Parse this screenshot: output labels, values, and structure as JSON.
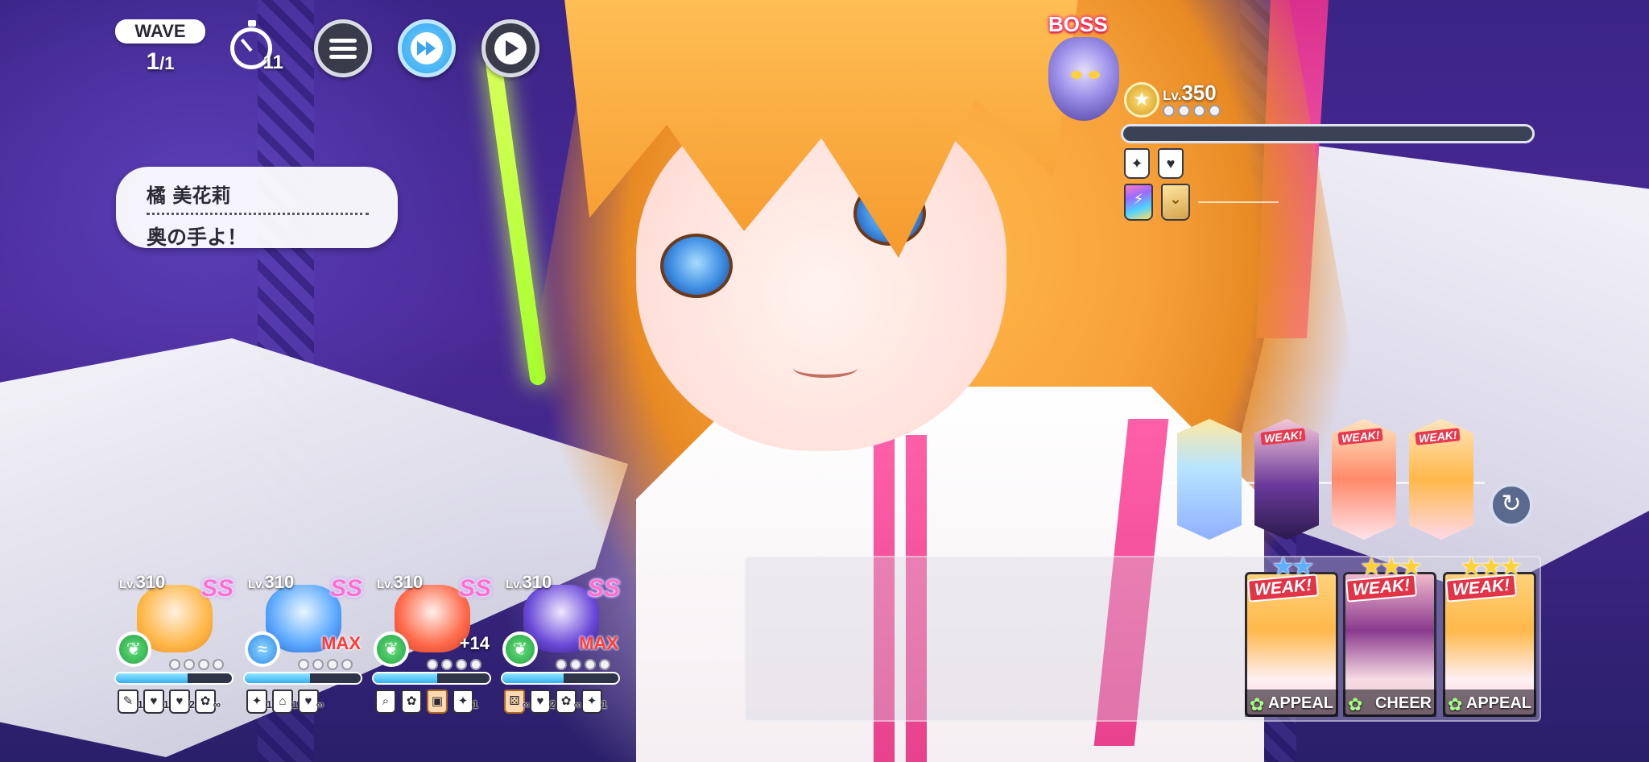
{
  "hud": {
    "wave_label": "WAVE",
    "wave_current": "1",
    "wave_total": "/1",
    "timer_value": "11"
  },
  "dialogue": {
    "speaker": "橘 美花莉",
    "text": "奥の手よ！"
  },
  "boss": {
    "tag": "BOSS",
    "level_prefix": "Lv.",
    "level": "350",
    "rank_icon": "star-medal-icon",
    "buffs_row1": [
      "sparkle-icon",
      "heart-infinity-icon"
    ],
    "buffs_row2": [
      "rainbow-crystal-icon",
      "gold-chevron-icon"
    ]
  },
  "party": [
    {
      "level_prefix": "Lv.",
      "level": "310",
      "rarity": "SS",
      "attribute": "leaf",
      "attr_symbol": "❦",
      "tag": "",
      "hp_fraction": 0.62,
      "skills": [
        {
          "icon": "pen-icon",
          "count": "1"
        },
        {
          "icon": "heart-icon",
          "count": "1"
        },
        {
          "icon": "heart-icon",
          "count": "2"
        },
        {
          "icon": "flower-icon",
          "count": "∞"
        }
      ]
    },
    {
      "level_prefix": "Lv.",
      "level": "310",
      "rarity": "SS",
      "attribute": "water",
      "attr_symbol": "≈",
      "tag": "MAX",
      "hp_fraction": 0.56,
      "skills": [
        {
          "icon": "sparkle-icon",
          "count": "1"
        },
        {
          "icon": "house-icon",
          "count": "1"
        },
        {
          "icon": "heart-icon",
          "count": "∞"
        }
      ]
    },
    {
      "level_prefix": "Lv.",
      "level": "310",
      "rarity": "SS",
      "attribute": "leaf",
      "attr_symbol": "❦",
      "tag": "+14",
      "hp_fraction": 0.55,
      "skills": [
        {
          "icon": "search-icon",
          "count": ""
        },
        {
          "icon": "flower-icon",
          "count": ""
        },
        {
          "icon": "card-icon",
          "count": ""
        },
        {
          "icon": "sparkle-icon",
          "count": "1"
        }
      ]
    },
    {
      "level_prefix": "Lv.",
      "level": "310",
      "rarity": "SS",
      "attribute": "leaf",
      "attr_symbol": "❦",
      "tag": "MAX",
      "hp_fraction": 0.53,
      "skills": [
        {
          "icon": "dice-icon",
          "count": "∞"
        },
        {
          "icon": "heart-icon",
          "count": "2"
        },
        {
          "icon": "flower-icon",
          "count": "∞"
        },
        {
          "icon": "sparkle-icon",
          "count": "1"
        }
      ]
    }
  ],
  "turn_order": [
    {
      "name": "turn-blue-hair",
      "weak": ""
    },
    {
      "name": "turn-purple-hair",
      "weak": "WEAK!"
    },
    {
      "name": "turn-red-hair",
      "weak": "WEAK!"
    },
    {
      "name": "turn-blonde-hair",
      "weak": "WEAK!"
    }
  ],
  "cards": [
    {
      "stars": "★★",
      "star_color": "blue",
      "weak": "WEAK!",
      "label": "APPEAL",
      "theme": "blonde"
    },
    {
      "stars": "★★★",
      "star_color": "gold",
      "weak": "WEAK!",
      "label": "CHEER",
      "theme": "purple"
    },
    {
      "stars": "★★★",
      "star_color": "gold",
      "weak": "WEAK!",
      "label": "APPEAL",
      "theme": "blonde"
    }
  ],
  "colors": {
    "accent_blue": "#3aa5ee",
    "weak_red": "#e23446",
    "max_red": "#ff3a3a",
    "rarity_pink": "#ff6fd0"
  }
}
